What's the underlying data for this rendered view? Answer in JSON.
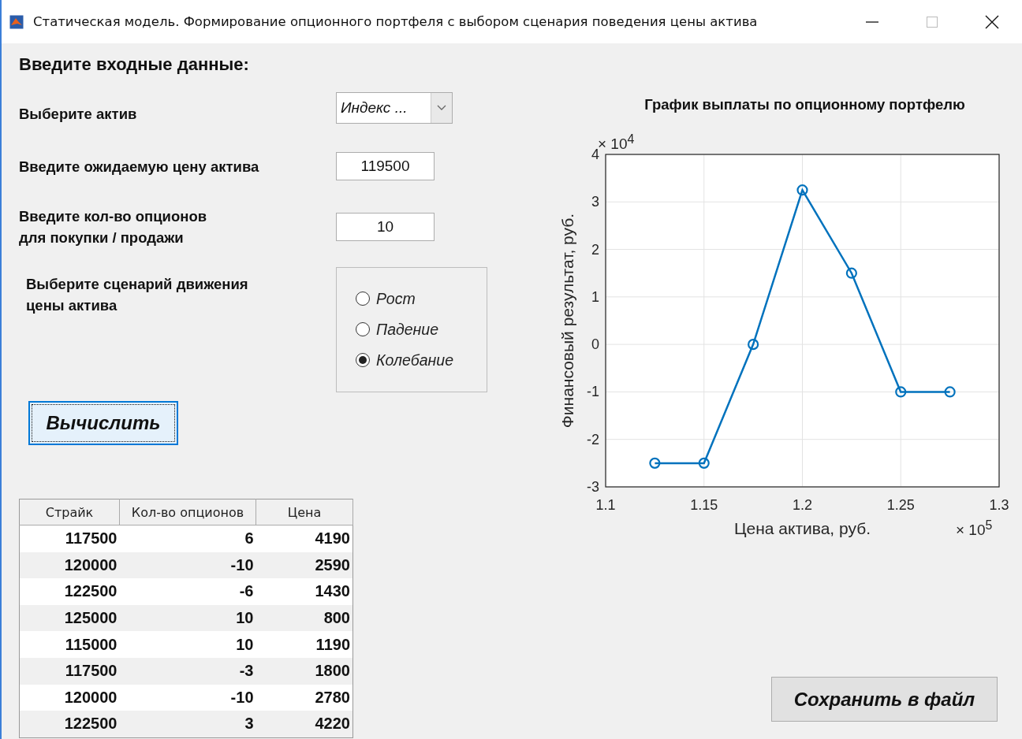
{
  "window": {
    "title": "Статическая модель. Формирование опционного портфеля с выбором сценария поведения цены актива"
  },
  "heading": "Введите входные данные:",
  "asset": {
    "label": "Выберите актив",
    "value": "Индекс ..."
  },
  "expected_price": {
    "label": "Введите ожидаемую цену актива",
    "value": "119500"
  },
  "quantity": {
    "label": "Введите кол-во опционов\nдля покупки / продажи",
    "value": "10"
  },
  "scenario": {
    "label": "Выберите сценарий движения\nцены актива",
    "options": [
      {
        "label": "Рост",
        "selected": false
      },
      {
        "label": "Падение",
        "selected": false
      },
      {
        "label": "Колебание",
        "selected": true
      }
    ]
  },
  "compute_button": "Вычислить",
  "table": {
    "columns": [
      "Страйк",
      "Кол-во опционов",
      "Цена"
    ],
    "rows": [
      [
        "117500",
        "6",
        "4190"
      ],
      [
        "120000",
        "-10",
        "2590"
      ],
      [
        "122500",
        "-6",
        "1430"
      ],
      [
        "125000",
        "10",
        "800"
      ],
      [
        "115000",
        "10",
        "1190"
      ],
      [
        "117500",
        "-3",
        "1800"
      ],
      [
        "120000",
        "-10",
        "2780"
      ],
      [
        "122500",
        "3",
        "4220"
      ]
    ]
  },
  "chart": {
    "chart_data": {
      "type": "line",
      "title": "График выплаты по опционному портфелю",
      "xlabel": "Цена актива, руб.",
      "ylabel": "Финансовый результат, руб.",
      "x": [
        1.125,
        1.15,
        1.175,
        1.2,
        1.225,
        1.25,
        1.275
      ],
      "grid": true,
      "series": [
        {
          "color": "#0072bd",
          "marker": "o",
          "values": [
            -2.5,
            -2.5,
            0,
            3.25,
            1.5,
            -1,
            -1
          ]
        }
      ],
      "xlim": [
        1.1,
        1.3
      ],
      "ylim": [
        -3,
        4
      ],
      "xticks": [
        {
          "value": 1.1,
          "label": "1.1"
        },
        {
          "value": 1.15,
          "label": "1.15"
        },
        {
          "value": 1.2,
          "label": "1.2"
        },
        {
          "value": 1.25,
          "label": "1.25"
        },
        {
          "value": 1.3,
          "label": "1.3"
        }
      ],
      "yticks": [
        -3,
        -2,
        -1,
        0,
        1,
        2,
        3,
        4
      ],
      "annotations": [
        {
          "text": "× 10$^{4}$"
        },
        {
          "text": "× 10$^{5}$"
        }
      ]
    }
  },
  "save_button": "Сохранить в файл"
}
